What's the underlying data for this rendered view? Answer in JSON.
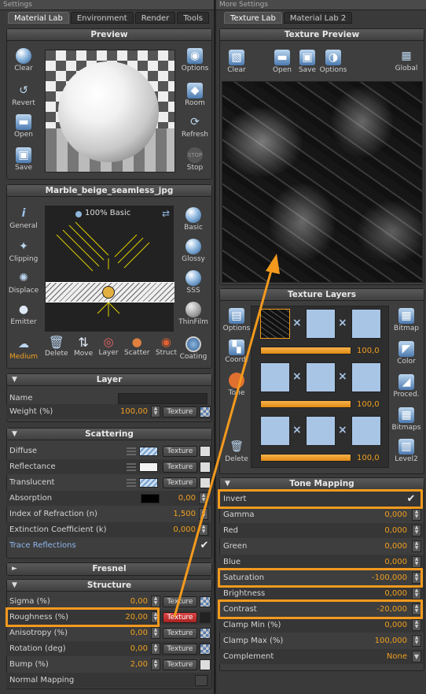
{
  "left_window": {
    "title": "Settings",
    "tabs": [
      "Material Lab",
      "Environment",
      "Render",
      "Tools"
    ],
    "preview": {
      "header": "Preview",
      "left_buttons": [
        "Clear",
        "Revert",
        "Open",
        "Save"
      ],
      "right_buttons": [
        "Options",
        "Room",
        "Refresh",
        "Stop"
      ]
    },
    "material": {
      "header": "Marble_beige_seamless_jpg",
      "basic_label": "100% Basic",
      "left_buttons": [
        "General",
        "Clipping",
        "Displace",
        "Emitter",
        "Medium"
      ],
      "right_buttons": [
        "Basic",
        "Glossy",
        "SSS",
        "ThinFilm",
        "Coating"
      ],
      "bottom_buttons": [
        "Delete",
        "Move",
        "Layer",
        "Scatter",
        "Struct"
      ]
    },
    "layer": {
      "header": "Layer",
      "name_label": "Name",
      "weight_label": "Weight (%)",
      "weight_value": "100,00",
      "texture_label": "Texture"
    },
    "scattering": {
      "header": "Scattering",
      "rows": [
        {
          "label": "Diffuse",
          "value": ""
        },
        {
          "label": "Reflectance",
          "value": ""
        },
        {
          "label": "Translucent",
          "value": ""
        },
        {
          "label": "Absorption",
          "value": "0,00"
        },
        {
          "label": "Index of Refraction (n)",
          "value": "1,500"
        },
        {
          "label": "Extinction Coefficient (k)",
          "value": "0,000"
        },
        {
          "label": "Trace Reflections",
          "value": ""
        }
      ]
    },
    "fresnel": {
      "header": "Fresnel"
    },
    "structure": {
      "header": "Structure",
      "rows": [
        {
          "label": "Sigma (%)",
          "value": "0,00"
        },
        {
          "label": "Roughness (%)",
          "value": "20,00"
        },
        {
          "label": "Anisotropy (%)",
          "value": "0,00"
        },
        {
          "label": "Rotation (deg)",
          "value": "0,00"
        },
        {
          "label": "Bump (%)",
          "value": "2,00"
        },
        {
          "label": "Normal Mapping",
          "value": ""
        }
      ]
    }
  },
  "right_window": {
    "title": "More Settings",
    "tabs": [
      "Texture Lab",
      "Material Lab 2"
    ],
    "texture_preview": {
      "header": "Texture Preview",
      "buttons": [
        "Clear",
        "Open",
        "Save",
        "Options",
        "Global"
      ]
    },
    "texture_layers": {
      "header": "Texture Layers",
      "left_buttons": [
        "Options",
        "Coord.",
        "Tone",
        "Delete"
      ],
      "right_buttons": [
        "Bitmap",
        "Color",
        "Proced.",
        "Bitmaps",
        "Level2"
      ],
      "slider_values": [
        "100,0",
        "100,0",
        "100,0"
      ],
      "slider_fraction": [
        1.0,
        1.0,
        1.0
      ]
    },
    "tone_mapping": {
      "header": "Tone Mapping",
      "rows": [
        {
          "label": "Invert",
          "value": ""
        },
        {
          "label": "Gamma",
          "value": "0,000"
        },
        {
          "label": "Red",
          "value": "0,000"
        },
        {
          "label": "Green",
          "value": "0,000"
        },
        {
          "label": "Blue",
          "value": "0,000"
        },
        {
          "label": "Saturation",
          "value": "-100,000"
        },
        {
          "label": "Brightness",
          "value": "0,000"
        },
        {
          "label": "Contrast",
          "value": "-20,000"
        },
        {
          "label": "Clamp Min (%)",
          "value": "0,000"
        },
        {
          "label": "Clamp Max (%)",
          "value": "100,000"
        },
        {
          "label": "Complement",
          "value": "None"
        }
      ]
    }
  },
  "colors": {
    "accent": "#f39a1e",
    "value_text": "#f0a020",
    "panel_bg": "#3e3e3e"
  }
}
